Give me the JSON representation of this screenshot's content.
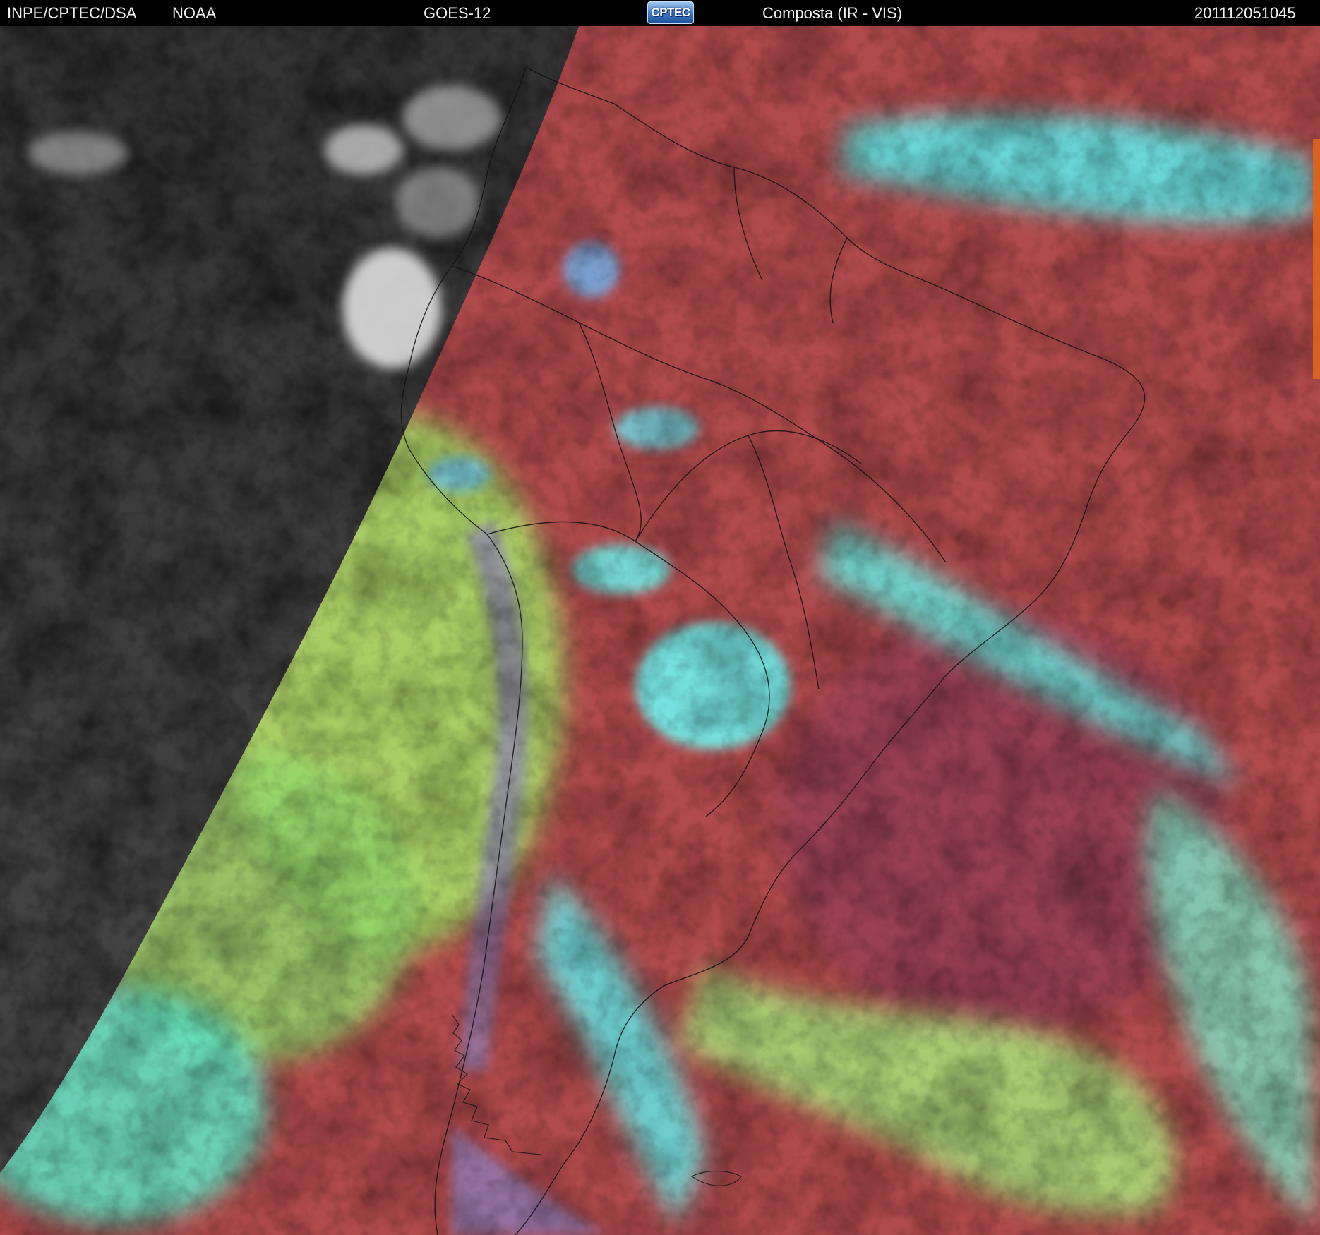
{
  "header": {
    "agency": "INPE/CPTEC/DSA",
    "source": "NOAA",
    "satellite": "GOES-12",
    "logo_text": "CPTEC",
    "product": "Composta (IR - VIS)",
    "timestamp": "201112051045"
  },
  "image": {
    "subject": "composite IR-VIS satellite image over South America",
    "colors": {
      "night_ir": "#3a3a3a",
      "land_clear": "#b9504a",
      "ocean_clear": "#a8464d",
      "low_cloud": "#9ee06a",
      "high_cloud": "#5ff0e8",
      "mid_cloud": "#8a7fb4",
      "border_lines": "#111111"
    }
  }
}
